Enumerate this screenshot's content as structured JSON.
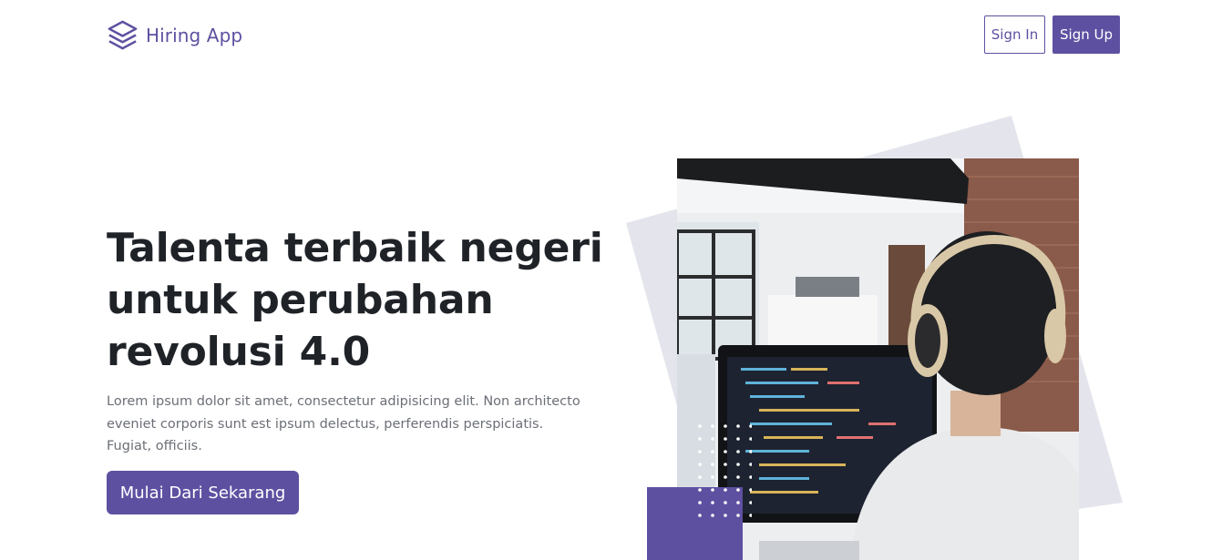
{
  "brand": {
    "name": "Hiring App",
    "icon": "layers-icon"
  },
  "nav": {
    "sign_in": "Sign In",
    "sign_up": "Sign Up"
  },
  "hero": {
    "title": "Talenta terbaik negeri untuk perubahan revolusi 4.0",
    "description": "Lorem ipsum dolor sit amet, consectetur adipisicing elit. Non architecto eveniet corporis sunt est ipsum delectus, perferendis perspiciatis. Fugiat, officiis.",
    "cta_label": "Mulai Dari Sekarang"
  },
  "colors": {
    "primary": "#5e50a1",
    "heading": "#1f2328",
    "muted": "#6b6f76",
    "shape_bg": "#e4e5ec"
  }
}
